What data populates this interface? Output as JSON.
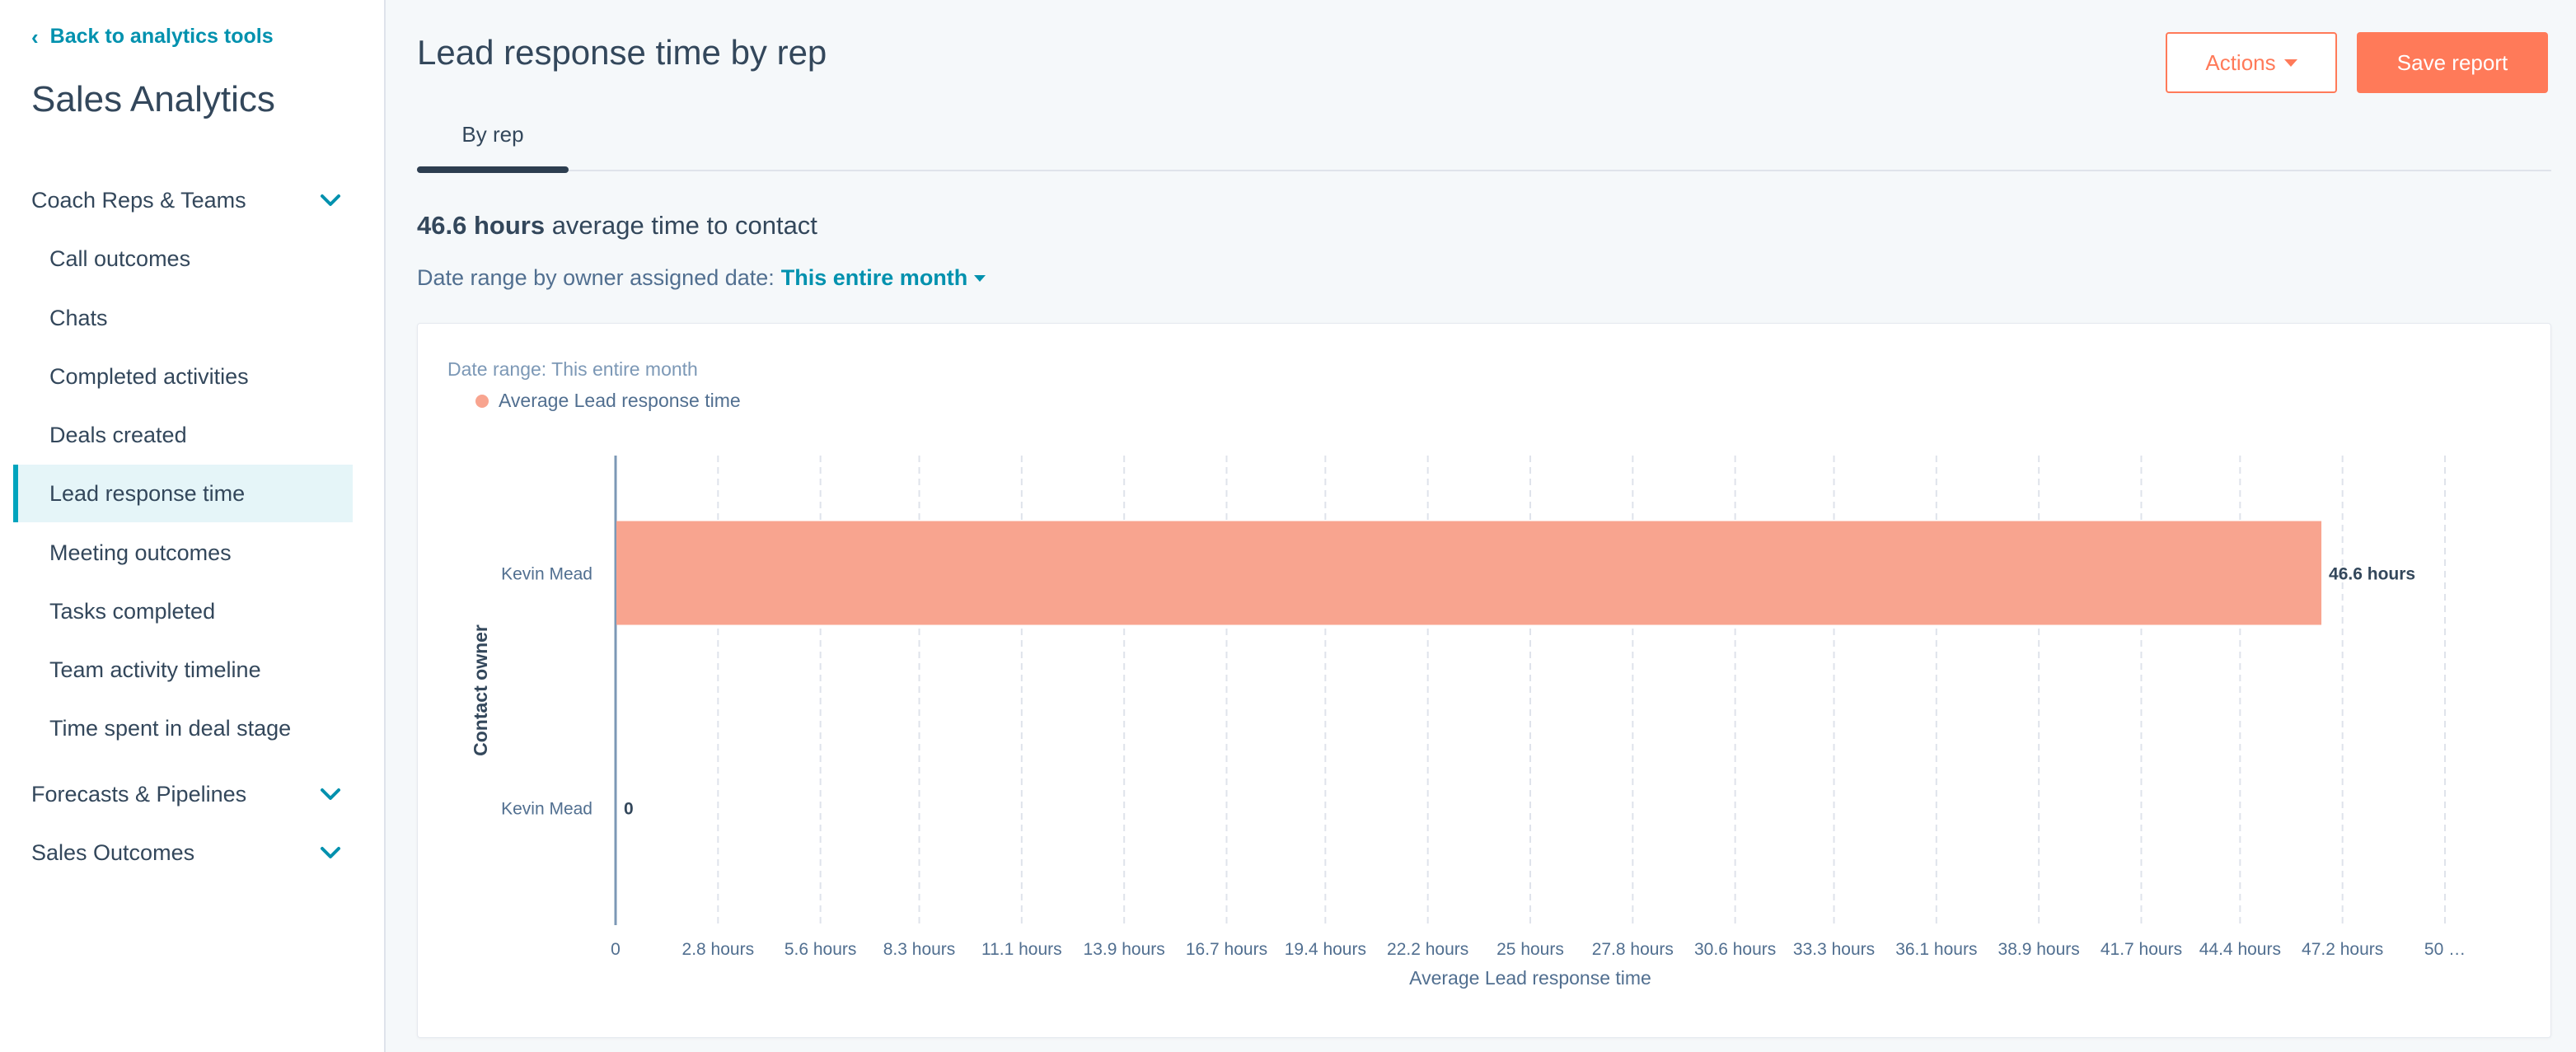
{
  "sidebar": {
    "back_label": "Back to analytics tools",
    "title": "Sales Analytics",
    "groups": [
      {
        "label": "Coach Reps & Teams",
        "expanded": true
      },
      {
        "label": "Forecasts & Pipelines",
        "expanded": false
      },
      {
        "label": "Sales Outcomes",
        "expanded": false
      }
    ],
    "items": [
      {
        "label": "Call outcomes"
      },
      {
        "label": "Chats"
      },
      {
        "label": "Completed activities"
      },
      {
        "label": "Deals created"
      },
      {
        "label": "Lead response time",
        "active": true
      },
      {
        "label": "Meeting outcomes"
      },
      {
        "label": "Tasks completed"
      },
      {
        "label": "Team activity timeline"
      },
      {
        "label": "Time spent in deal stage"
      }
    ]
  },
  "header": {
    "title": "Lead response time by rep",
    "actions_label": "Actions",
    "save_label": "Save report",
    "tab_label": "By rep"
  },
  "summary": {
    "value": "46.6 hours",
    "text": "average time to contact"
  },
  "date_filter": {
    "label": "Date range by owner assigned date:",
    "value": "This entire month"
  },
  "card": {
    "date_range": "Date range: This entire month",
    "legend": "Average Lead response time"
  },
  "colors": {
    "accent": "#ff7a59",
    "link": "#0091ae",
    "bar": "#f8a48f",
    "text": "#33475b",
    "active_bg": "#e5f5f8"
  },
  "chart_data": {
    "type": "bar",
    "orientation": "horizontal",
    "categories": [
      "Kevin Mead",
      "Kevin Mead"
    ],
    "values": [
      46.6,
      0
    ],
    "value_labels": [
      "46.6 hours",
      "0"
    ],
    "series": [
      {
        "name": "Average Lead response time",
        "values": [
          46.6,
          0
        ]
      }
    ],
    "xlabel": "Average Lead response time",
    "ylabel": "Contact owner",
    "xticks": [
      0,
      2.8,
      5.6,
      8.3,
      11.1,
      13.9,
      16.7,
      19.4,
      22.2,
      25,
      27.8,
      30.6,
      33.3,
      36.1,
      38.9,
      41.7,
      44.4,
      47.2,
      50
    ],
    "xtick_labels": [
      "0",
      "2.8 hours",
      "5.6 hours",
      "8.3 hours",
      "11.1 hours",
      "13.9 hours",
      "16.7 hours",
      "19.4 hours",
      "22.2 hours",
      "25 hours",
      "27.8 hours",
      "30.6 hours",
      "33.3 hours",
      "36.1 hours",
      "38.9 hours",
      "41.7 hours",
      "44.4 hours",
      "47.2 hours",
      "50 …"
    ],
    "xlim": [
      0,
      50
    ],
    "grid": true,
    "legend_position": "top-left"
  }
}
